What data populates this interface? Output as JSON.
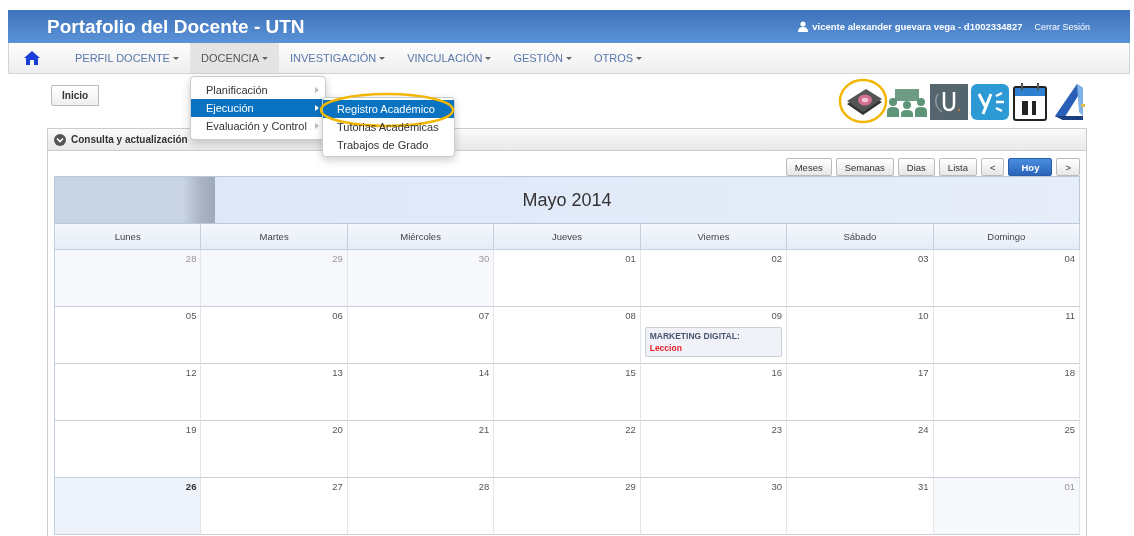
{
  "header": {
    "title": "Portafolio del Docente - UTN",
    "user": "vicente alexander guevara vega - d1002334827",
    "logout": "Cerrar Sesión"
  },
  "nav": [
    {
      "label": "PERFIL DOCENTE",
      "selected": false
    },
    {
      "label": "DOCENCIA",
      "selected": true,
      "menu": [
        {
          "label": "Planificación",
          "selected": false
        },
        {
          "label": "Ejecución",
          "selected": true,
          "submenu": [
            {
              "label": "Registro Académico",
              "selected": true,
              "circled": true
            },
            {
              "label": "Tutorias Académicas",
              "selected": false,
              "circled": false
            },
            {
              "label": "Trabajos de Grado",
              "selected": false,
              "circled": false
            }
          ]
        },
        {
          "label": "Evaluación y Control",
          "selected": false
        }
      ]
    },
    {
      "label": "INVESTIGACIÓN",
      "selected": false
    },
    {
      "label": "VINCULACIÓN",
      "selected": false
    },
    {
      "label": "GESTIÓN",
      "selected": false
    },
    {
      "label": "OTROS",
      "selected": false
    }
  ],
  "breadcrumb": "Inicio",
  "apps": [
    {
      "kind": "ebook",
      "circled": true
    },
    {
      "kind": "group",
      "circled": false
    },
    {
      "kind": "u-logo",
      "circled": false
    },
    {
      "kind": "y-logo",
      "circled": false
    },
    {
      "kind": "calendar",
      "circled": false
    },
    {
      "kind": "book",
      "circled": false
    }
  ],
  "panel": {
    "title": "Consulta y actualización"
  },
  "calendar": {
    "views": [
      {
        "label": "Meses",
        "kind": "default"
      },
      {
        "label": "Semanas",
        "kind": "default"
      },
      {
        "label": "Dias",
        "kind": "default"
      },
      {
        "label": "Lista",
        "kind": "default"
      },
      {
        "label": "<",
        "kind": "default"
      },
      {
        "label": "Hoy",
        "kind": "primary"
      },
      {
        "label": ">",
        "kind": "default"
      }
    ],
    "title": "Mayo 2014",
    "weekdays": [
      "Lunes",
      "Martes",
      "Miércoles",
      "Jueves",
      "Viernes",
      "Sábado",
      "Domingo"
    ],
    "weeks": [
      [
        {
          "day": "28",
          "other_month": true,
          "today": false
        },
        {
          "day": "29",
          "other_month": true,
          "today": false
        },
        {
          "day": "30",
          "other_month": true,
          "today": false
        },
        {
          "day": "01",
          "other_month": false,
          "today": false
        },
        {
          "day": "02",
          "other_month": false,
          "today": false
        },
        {
          "day": "03",
          "other_month": false,
          "today": false
        },
        {
          "day": "04",
          "other_month": false,
          "today": false
        }
      ],
      [
        {
          "day": "05",
          "other_month": false,
          "today": false
        },
        {
          "day": "06",
          "other_month": false,
          "today": false
        },
        {
          "day": "07",
          "other_month": false,
          "today": false
        },
        {
          "day": "08",
          "other_month": false,
          "today": false
        },
        {
          "day": "09",
          "other_month": false,
          "today": false,
          "events": [
            {
              "title": "MARKETING DIGITAL:",
              "type": "Leccion"
            }
          ]
        },
        {
          "day": "10",
          "other_month": false,
          "today": false
        },
        {
          "day": "11",
          "other_month": false,
          "today": false
        }
      ],
      [
        {
          "day": "12",
          "other_month": false,
          "today": false
        },
        {
          "day": "13",
          "other_month": false,
          "today": false
        },
        {
          "day": "14",
          "other_month": false,
          "today": false
        },
        {
          "day": "15",
          "other_month": false,
          "today": false
        },
        {
          "day": "16",
          "other_month": false,
          "today": false
        },
        {
          "day": "17",
          "other_month": false,
          "today": false
        },
        {
          "day": "18",
          "other_month": false,
          "today": false
        }
      ],
      [
        {
          "day": "19",
          "other_month": false,
          "today": false
        },
        {
          "day": "20",
          "other_month": false,
          "today": false
        },
        {
          "day": "21",
          "other_month": false,
          "today": false
        },
        {
          "day": "22",
          "other_month": false,
          "today": false
        },
        {
          "day": "23",
          "other_month": false,
          "today": false
        },
        {
          "day": "24",
          "other_month": false,
          "today": false
        },
        {
          "day": "25",
          "other_month": false,
          "today": false
        }
      ],
      [
        {
          "day": "26",
          "other_month": false,
          "today": true
        },
        {
          "day": "27",
          "other_month": false,
          "today": false
        },
        {
          "day": "28",
          "other_month": false,
          "today": false
        },
        {
          "day": "29",
          "other_month": false,
          "today": false
        },
        {
          "day": "30",
          "other_month": false,
          "today": false
        },
        {
          "day": "31",
          "other_month": false,
          "today": false
        },
        {
          "day": "01",
          "other_month": true,
          "today": false
        }
      ]
    ]
  }
}
